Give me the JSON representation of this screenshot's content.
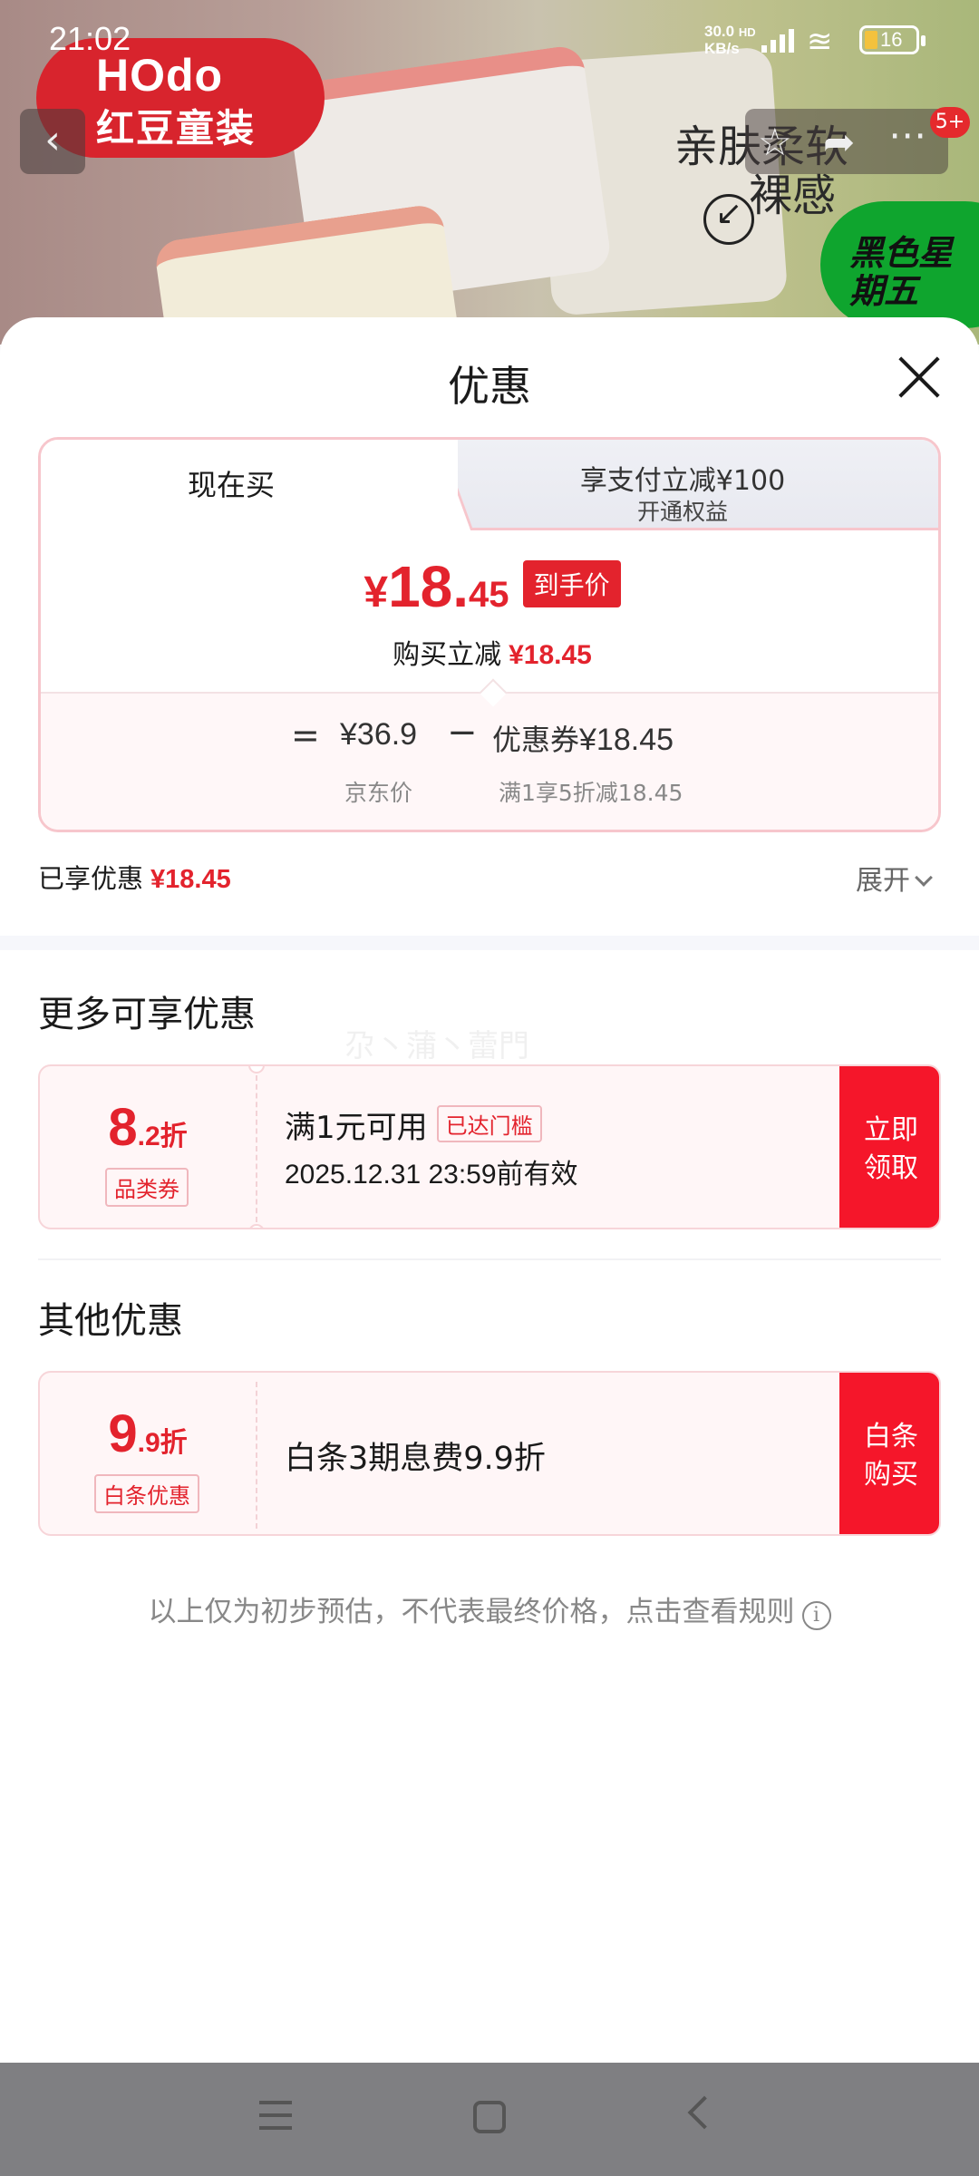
{
  "status_bar": {
    "time": "21:02",
    "net_speed": "30.0",
    "net_unit": "KB/s",
    "net_type": "HD",
    "battery": "16"
  },
  "background": {
    "brand_en": "HOdo",
    "brand_cn": "红豆童装",
    "text1": "亲肤柔软",
    "text2": "裸感",
    "promo": "黑色星期五",
    "notif_count": "5+"
  },
  "sheet": {
    "title": "优惠",
    "tabs": {
      "now": "现在买",
      "pay_main": "享支付立减¥100",
      "pay_sub": "开通权益"
    },
    "price": {
      "currency": "¥",
      "integer": "18.",
      "decimal": "45",
      "tag": "到手价"
    },
    "reduce": {
      "label": "购买立减",
      "value": "¥18.45"
    },
    "formula": {
      "equals": "=",
      "jd_price": "¥36.9",
      "minus": "−",
      "coupon_label": "优惠券",
      "coupon_value": "¥18.45",
      "jd_price_label": "京东价",
      "coupon_desc": "满1享5折减18.45"
    },
    "enjoyed": {
      "label": "已享优惠",
      "value": "¥18.45",
      "expand": "展开"
    },
    "more_title": "更多可享优惠",
    "watermark": "尕丶蒲丶蕾門",
    "coupon1": {
      "discount_big": "8",
      "discount_small": ".2折",
      "type": "品类券",
      "condition": "满1元可用",
      "reached": "已达门槛",
      "valid": "2025.12.31 23:59前有效",
      "action": "立即领取"
    },
    "other_title": "其他优惠",
    "coupon2": {
      "discount_big": "9",
      "discount_small": ".9折",
      "type": "白条优惠",
      "desc": "白条3期息费9.9折",
      "action": "白条购买"
    },
    "footnote": "以上仅为初步预估，不代表最终价格，点击查看规则"
  },
  "colors": {
    "accent_red": "#e3232d",
    "action_red": "#f5162a",
    "border_pink": "#f7c6cc"
  },
  "icons": [
    "back-icon",
    "star-icon",
    "share-icon",
    "more-icon",
    "close-icon",
    "chevron-down-icon",
    "info-icon",
    "nav-menu-icon",
    "nav-home-icon",
    "nav-back-icon",
    "wifi-icon",
    "signal-icon",
    "battery-icon"
  ]
}
